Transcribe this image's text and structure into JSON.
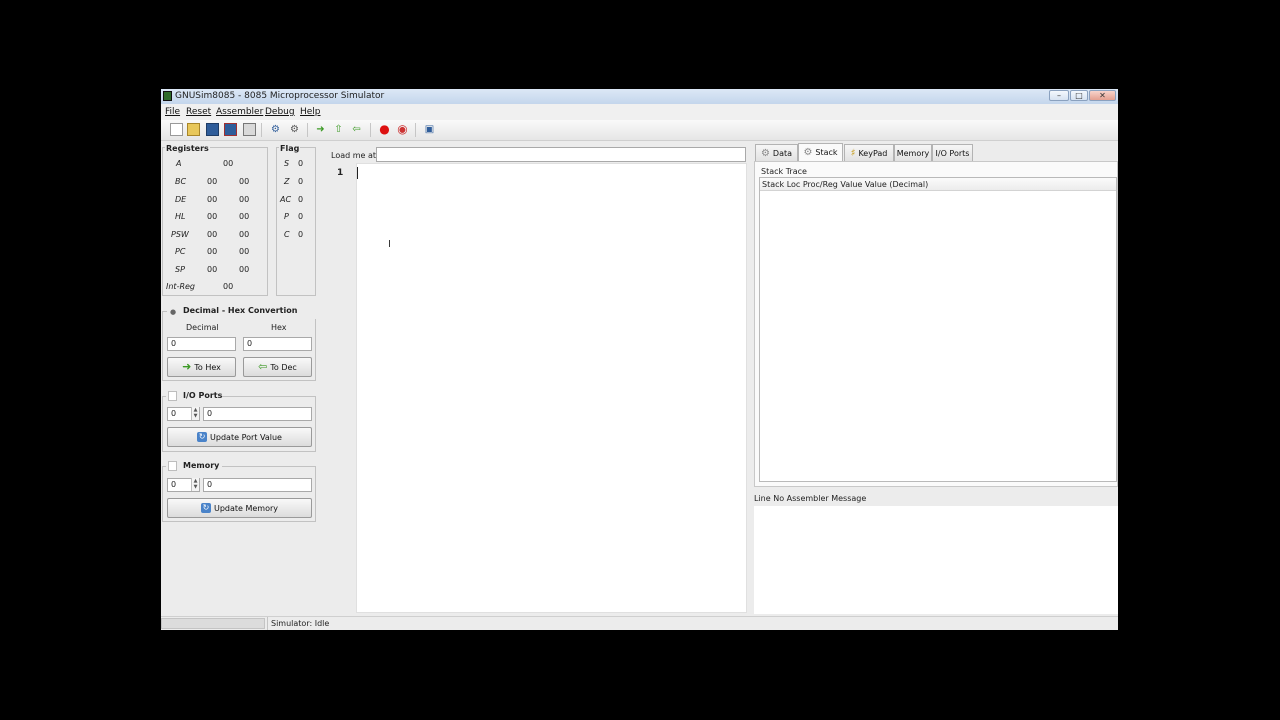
{
  "window": {
    "title": "GNUSim8085 - 8085 Microprocessor Simulator",
    "controls": [
      "–",
      "□",
      "✕"
    ]
  },
  "menu": [
    "File",
    "Reset",
    "Assembler",
    "Debug",
    "Help"
  ],
  "toolbar_icons": [
    "new-file-icon",
    "open-folder-icon",
    "save-icon",
    "save-as-icon",
    "print-icon",
    "assemble-icon",
    "assemble-load-icon",
    "step-in-icon",
    "step-over-icon",
    "step-out-icon",
    "breakpoint-icon",
    "stop-icon",
    "execute-icon"
  ],
  "registers": {
    "title": "Registers",
    "rows": [
      {
        "name": "A",
        "v1": "00",
        "v2": ""
      },
      {
        "name": "BC",
        "v1": "00",
        "v2": "00"
      },
      {
        "name": "DE",
        "v1": "00",
        "v2": "00"
      },
      {
        "name": "HL",
        "v1": "00",
        "v2": "00"
      },
      {
        "name": "PSW",
        "v1": "00",
        "v2": "00"
      },
      {
        "name": "PC",
        "v1": "00",
        "v2": "00"
      },
      {
        "name": "SP",
        "v1": "00",
        "v2": "00"
      },
      {
        "name": "Int-Reg",
        "v1": "00",
        "v2": ""
      }
    ]
  },
  "flags": {
    "title": "Flag",
    "rows": [
      {
        "name": "S",
        "value": "0"
      },
      {
        "name": "Z",
        "value": "0"
      },
      {
        "name": "AC",
        "value": "0"
      },
      {
        "name": "P",
        "value": "0"
      },
      {
        "name": "C",
        "value": "0"
      }
    ]
  },
  "conversion": {
    "title": "Decimal - Hex Convertion",
    "decimal_label": "Decimal",
    "hex_label": "Hex",
    "decimal_value": "0",
    "hex_value": "0",
    "to_hex": "To Hex",
    "to_dec": "To Dec"
  },
  "io_ports": {
    "title": "I/O Ports",
    "port": "0",
    "value": "0",
    "button": "Update Port Value"
  },
  "memory": {
    "title": "Memory",
    "address": "0",
    "value": "0",
    "button": "Update Memory"
  },
  "editor": {
    "load_label": "Load me at",
    "load_value": "",
    "line_number": "1"
  },
  "tabs": [
    "Data",
    "Stack",
    "KeyPad",
    "Memory",
    "I/O Ports"
  ],
  "active_tab": "Stack",
  "stack": {
    "title": "Stack Trace",
    "header": "Stack Loc Proc/Reg Value Value (Decimal)"
  },
  "messages": {
    "header": "Line No Assembler Message"
  },
  "status": {
    "text": "Simulator: Idle"
  }
}
